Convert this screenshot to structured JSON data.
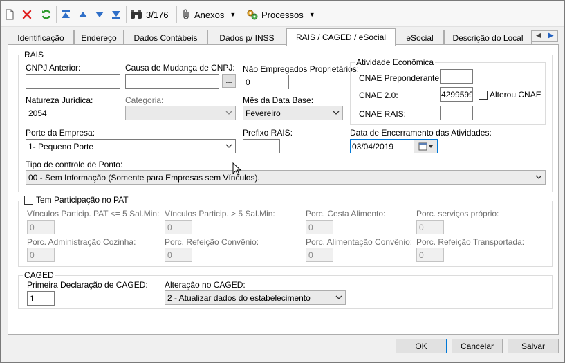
{
  "toolbar": {
    "record_counter": "3/176",
    "anexos_label": "Anexos",
    "processos_label": "Processos"
  },
  "tabs": [
    {
      "label": "Identificação"
    },
    {
      "label": "Endereço"
    },
    {
      "label": "Dados Contábeis"
    },
    {
      "label": "Dados p/ INSS"
    },
    {
      "label": "RAIS / CAGED / eSocial",
      "active": true
    },
    {
      "label": "eSocial"
    },
    {
      "label": "Descrição do Local"
    }
  ],
  "rais": {
    "title": "RAIS",
    "cnpj_anterior_label": "CNPJ Anterior:",
    "cnpj_anterior_value": "",
    "causa_label": "Causa de Mudança de CNPJ:",
    "causa_value": "",
    "causa_button": "...",
    "nao_empregados_label": "Não Empregados Proprietários:",
    "nao_empregados_value": "0",
    "natureza_label": "Natureza Jurídica:",
    "natureza_value": "2054",
    "categoria_label": "Categoria:",
    "categoria_value": "",
    "mes_label": "Mês da Data Base:",
    "mes_value": "Fevereiro",
    "porte_label": "Porte da Empresa:",
    "porte_value": "1- Pequeno Porte",
    "prefixo_label": "Prefixo RAIS:",
    "prefixo_value": "",
    "data_enc_label": "Data de Encerramento das Atividades:",
    "data_enc_value": "03/04/2019",
    "tipo_ponto_label": "Tipo de controle de Ponto:",
    "tipo_ponto_value": "00 - Sem Informação (Somente para Empresas sem Vínculos)."
  },
  "atividade": {
    "title": "Atividade Econômica",
    "cnae_preponderante_label": "CNAE Preponderante:",
    "cnae_preponderante_value": "",
    "cnae20_label": "CNAE 2.0:",
    "cnae20_value": "4299599",
    "alterou_cnae_label": "Alterou CNAE",
    "cnae_rais_label": "CNAE RAIS:",
    "cnae_rais_value": ""
  },
  "pat": {
    "title": "Tem Participação no PAT",
    "vinc_le5_label": "Vínculos Particip. PAT <= 5 Sal.Min:",
    "vinc_le5_value": "0",
    "vinc_gt5_label": "Vínculos Particip. > 5 Sal.Min:",
    "vinc_gt5_value": "0",
    "cesta_label": "Porc. Cesta Alimento:",
    "cesta_value": "0",
    "servicos_label": "Porc. serviços próprio:",
    "servicos_value": "0",
    "adm_cozinha_label": "Porc. Administração Cozinha:",
    "adm_cozinha_value": "0",
    "refeicao_conv_label": "Porc. Refeição Convênio:",
    "refeicao_conv_value": "0",
    "alim_conv_label": "Porc. Alimentação Convênio:",
    "alim_conv_value": "0",
    "refeicao_transp_label": "Porc. Refeição Transportada:",
    "refeicao_transp_value": "0"
  },
  "caged": {
    "title": "CAGED",
    "primeira_label": "Primeira Declaração de CAGED:",
    "primeira_value": "1",
    "alteracao_label": "Alteração no CAGED:",
    "alteracao_value": "2 - Atualizar dados do estabelecimento"
  },
  "buttons": {
    "ok": "OK",
    "cancelar": "Cancelar",
    "salvar": "Salvar"
  }
}
